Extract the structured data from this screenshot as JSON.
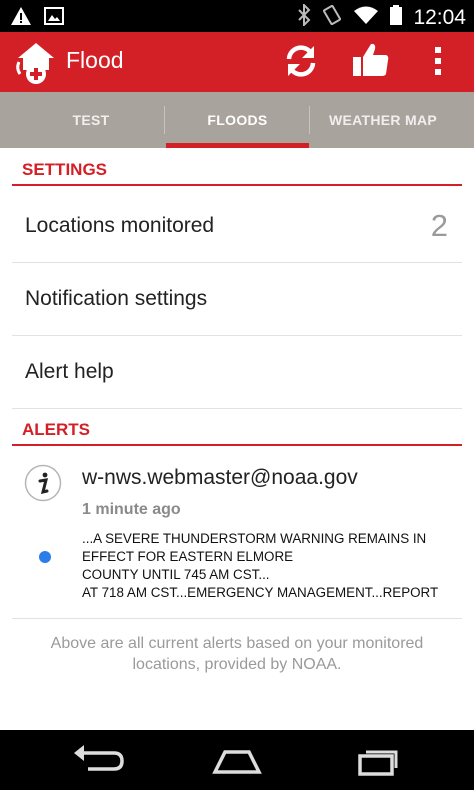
{
  "status_bar": {
    "time": "12:04",
    "icons_left": [
      "warning-icon",
      "image-icon"
    ],
    "icons_right": [
      "bluetooth-icon",
      "vibrate-icon",
      "wifi-icon",
      "battery-icon"
    ]
  },
  "app_bar": {
    "title": "Flood",
    "actions": [
      "refresh-icon",
      "thumbs-up-icon",
      "overflow-menu-icon"
    ]
  },
  "tabs": [
    {
      "label": "TEST",
      "active": false
    },
    {
      "label": "FLOODS",
      "active": true
    },
    {
      "label": "WEATHER MAP",
      "active": false
    }
  ],
  "settings": {
    "header": "SETTINGS",
    "items": [
      {
        "label": "Locations monitored",
        "value": "2"
      },
      {
        "label": "Notification settings"
      },
      {
        "label": "Alert help"
      }
    ]
  },
  "alerts": {
    "header": "ALERTS",
    "items": [
      {
        "sender": "w-nws.webmaster@noaa.gov",
        "time": "1 minute ago",
        "text_lines": [
          "...A SEVERE THUNDERSTORM WARNING REMAINS IN",
          "EFFECT FOR EASTERN ELMORE",
          "COUNTY UNTIL 745 AM CST...",
          "AT 718 AM CST...EMERGENCY MANAGEMENT...REPORT"
        ]
      }
    ],
    "footer": "Above are all current alerts based on your monitored locations, provided by NOAA."
  },
  "colors": {
    "accent": "#d32026",
    "tab_bar": "#a9a39d",
    "unread_dot": "#2b7de9"
  },
  "nav_bar": [
    "back-icon",
    "home-icon",
    "recents-icon"
  ]
}
